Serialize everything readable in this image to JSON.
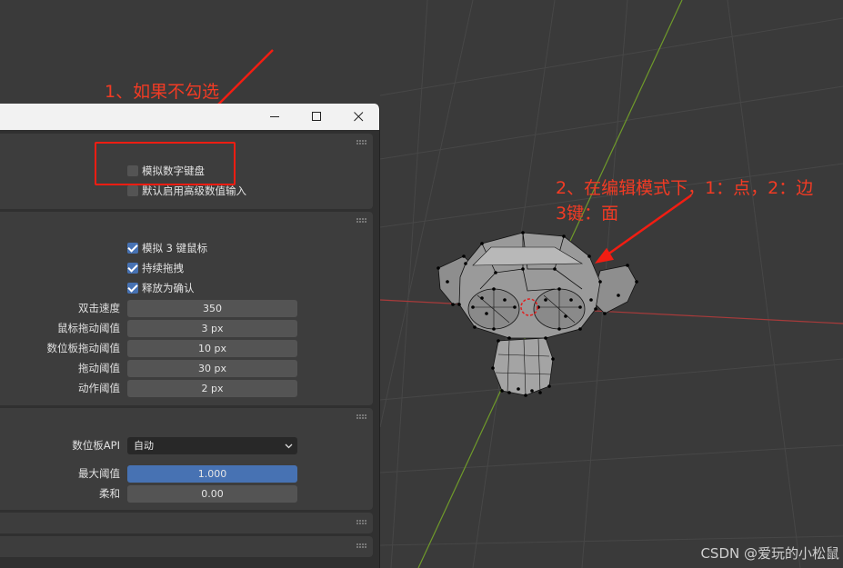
{
  "annotations": {
    "note1": "1、如果不勾选",
    "note2_line1": "2、在编辑模式下，1：点，2：边",
    "note2_line2": "3键：面"
  },
  "window": {
    "minimize_icon": "minimize-icon",
    "maximize_icon": "maximize-icon",
    "close_icon": "close-icon"
  },
  "keyboard_panel": {
    "emulate_numpad": {
      "label": "模拟数字键盘",
      "checked": false
    },
    "default_advanced_numeric_input": {
      "label": "默认启用高级数值输入",
      "checked": false
    }
  },
  "mouse_panel": {
    "emulate_3_button": {
      "label": "模拟 3 键鼠标",
      "checked": true
    },
    "continuous_grab": {
      "label": "持续拖拽",
      "checked": true
    },
    "release_confirms": {
      "label": "释放为确认",
      "checked": true
    },
    "properties": [
      {
        "label": "双击速度",
        "value": "350"
      },
      {
        "label": "鼠标拖动阈值",
        "value": "3 px"
      },
      {
        "label": "数位板拖动阈值",
        "value": "10 px"
      },
      {
        "label": "拖动阈值",
        "value": "30 px"
      },
      {
        "label": "动作阈值",
        "value": "2 px"
      }
    ]
  },
  "tablet_panel": {
    "api_label": "数位板API",
    "api_value": "自动",
    "max_threshold_label": "最大阈值",
    "max_threshold_value": "1.000",
    "max_threshold_fraction": 1.0,
    "softness_label": "柔和",
    "softness_value": "0.00",
    "softness_fraction": 0.0
  },
  "watermark": "CSDN @爱玩的小松鼠",
  "colors": {
    "viewport_bg": "#3a3a3a",
    "panel_bg": "#3d3d3d",
    "accent_blue": "#4772b3",
    "annotation_red": "#f23b24",
    "axis_red": "#a83a3a",
    "axis_green": "#6f9a2a"
  }
}
